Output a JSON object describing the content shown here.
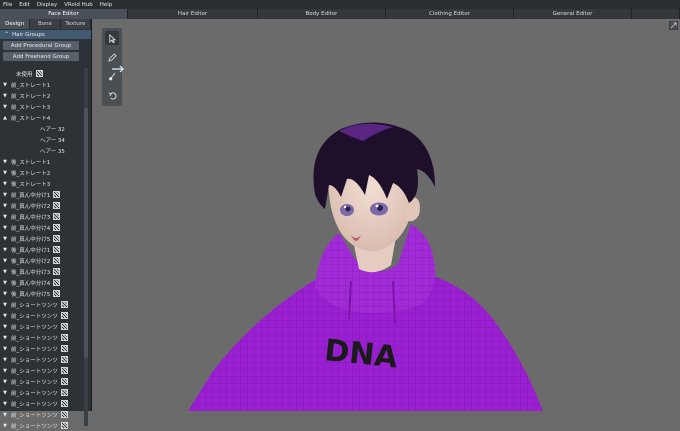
{
  "menu": [
    "File",
    "Edit",
    "Display",
    "VRoid Hub",
    "Help"
  ],
  "editor_tabs": [
    {
      "label": "Face Editor",
      "width": 128,
      "active": true
    },
    {
      "label": "Hair Editor",
      "width": 130,
      "active": false
    },
    {
      "label": "Body Editor",
      "width": 128,
      "active": false
    },
    {
      "label": "Clothing Editor",
      "width": 128,
      "active": false
    },
    {
      "label": "General Editor",
      "width": 118,
      "active": false
    }
  ],
  "sidebar": {
    "subtabs": [
      "Design",
      "Bone",
      "Texture"
    ],
    "group_title": "Hair Groups",
    "add_procedural": "Add Procedural Group",
    "add_freehand": "Add Freehand Group",
    "rows": [
      {
        "caret": "",
        "label": "未使用",
        "icon": true,
        "indent": 1
      },
      {
        "caret": "v",
        "label": "前_ストレート1",
        "icon": false
      },
      {
        "caret": "v",
        "label": "前_ストレート2",
        "icon": false
      },
      {
        "caret": "v",
        "label": "前_ストレート3",
        "icon": false
      },
      {
        "caret": "^",
        "label": "前_ストレート4",
        "icon": false
      },
      {
        "caret": "",
        "label": "ヘアー 32",
        "icon": false,
        "child": true
      },
      {
        "caret": "",
        "label": "ヘアー 34",
        "icon": false,
        "child": true
      },
      {
        "caret": "",
        "label": "ヘアー 35",
        "icon": false,
        "child": true
      },
      {
        "caret": "v",
        "label": "後_ストレート1",
        "icon": false
      },
      {
        "caret": "v",
        "label": "後_ストレート2",
        "icon": false
      },
      {
        "caret": "v",
        "label": "後_ストレート3",
        "icon": false
      },
      {
        "caret": "v",
        "label": "前_真ん中分け1",
        "icon": true
      },
      {
        "caret": "v",
        "label": "前_真ん中分け2",
        "icon": true
      },
      {
        "caret": "v",
        "label": "前_真ん中分け3",
        "icon": true
      },
      {
        "caret": "v",
        "label": "前_真ん中分け4",
        "icon": true
      },
      {
        "caret": "v",
        "label": "前_真ん中分け5",
        "icon": true
      },
      {
        "caret": "v",
        "label": "後_真ん中分け1",
        "icon": true
      },
      {
        "caret": "v",
        "label": "後_真ん中分け2",
        "icon": true
      },
      {
        "caret": "v",
        "label": "後_真ん中分け3",
        "icon": true
      },
      {
        "caret": "v",
        "label": "後_真ん中分け4",
        "icon": true
      },
      {
        "caret": "v",
        "label": "後_真ん中分け5",
        "icon": true
      },
      {
        "caret": "v",
        "label": "前_ショートツンツ",
        "icon": true
      },
      {
        "caret": "v",
        "label": "前_ショートツンツ",
        "icon": true
      },
      {
        "caret": "v",
        "label": "前_ショートツンツ",
        "icon": true
      },
      {
        "caret": "v",
        "label": "前_ショートツンツ",
        "icon": true
      },
      {
        "caret": "v",
        "label": "前_ショートツンツ",
        "icon": true
      },
      {
        "caret": "v",
        "label": "前_ショートツンツ",
        "icon": true
      },
      {
        "caret": "v",
        "label": "前_ショートツンツ",
        "icon": true
      },
      {
        "caret": "v",
        "label": "前_ショートツンツ",
        "icon": true
      },
      {
        "caret": "v",
        "label": "前_ショートツンツ",
        "icon": true
      },
      {
        "caret": "v",
        "label": "前_ショートツンツ",
        "icon": true
      },
      {
        "caret": "v",
        "label": "前_ショートツンツ",
        "icon": true
      },
      {
        "caret": "v",
        "label": "前_ショートツンツ",
        "icon": true
      }
    ]
  },
  "viewport": {
    "hoodie_text": "DNA",
    "tools": [
      "select-tool-icon",
      "pen-tool-icon",
      "brush-tool-icon",
      "undo-tool-icon"
    ]
  }
}
